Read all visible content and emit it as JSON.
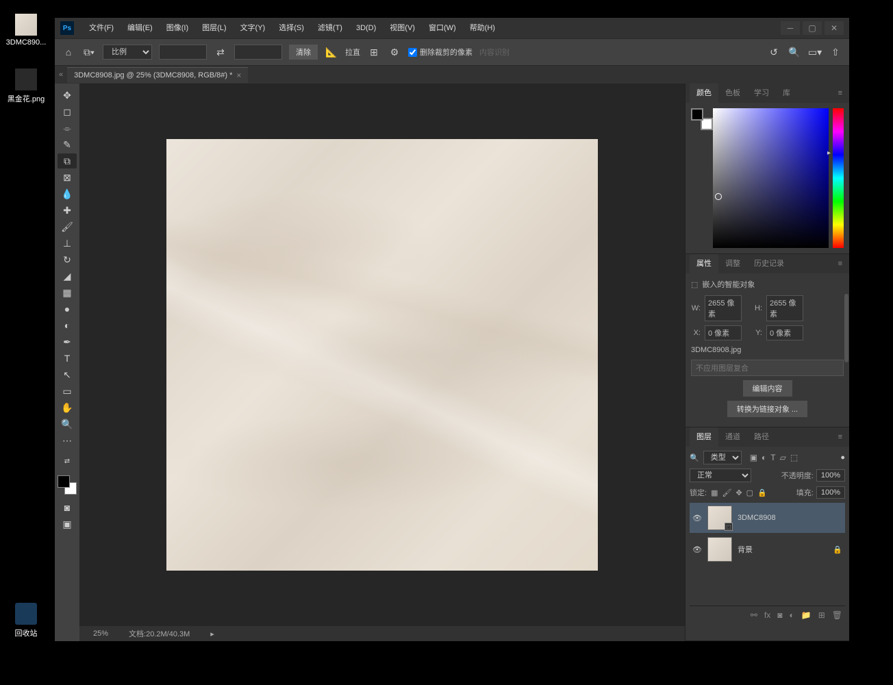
{
  "desktop": {
    "icon1": "3DMC890...",
    "icon2": "黑金花.png",
    "trash": "回收站"
  },
  "menu": {
    "file": "文件(F)",
    "edit": "编辑(E)",
    "image": "图像(I)",
    "layer": "图层(L)",
    "type": "文字(Y)",
    "select": "选择(S)",
    "filter": "滤镜(T)",
    "threed": "3D(D)",
    "view": "视图(V)",
    "window": "窗口(W)",
    "help": "帮助(H)"
  },
  "optbar": {
    "ratio": "比例",
    "clear": "清除",
    "straighten": "拉直",
    "deleteCropped": "删除裁剪的像素",
    "contentAware": "内容识别"
  },
  "doc": {
    "tab": "3DMC8908.jpg @ 25% (3DMC8908, RGB/8#) *"
  },
  "status": {
    "zoom": "25%",
    "docsize": "文档:20.2M/40.3M"
  },
  "panels": {
    "color": {
      "t1": "颜色",
      "t2": "色板",
      "t3": "学习",
      "t4": "库"
    },
    "props": {
      "t1": "属性",
      "t2": "调整",
      "t3": "历史记录",
      "type": "嵌入的智能对象",
      "wLabel": "W:",
      "wVal": "2655 像素",
      "hLabel": "H:",
      "hVal": "2655 像素",
      "xLabel": "X:",
      "xVal": "0 像素",
      "yLabel": "Y:",
      "yVal": "0 像素",
      "filename": "3DMC8908.jpg",
      "layerComp": "不应用图层复合",
      "editBtn": "编辑内容",
      "convertBtn": "转换为链接对象 ..."
    },
    "layers": {
      "t1": "图层",
      "t2": "通道",
      "t3": "路径",
      "kind": "类型",
      "blend": "正常",
      "opacityLabel": "不透明度:",
      "opacity": "100%",
      "lockLabel": "锁定:",
      "fillLabel": "填充:",
      "fill": "100%",
      "layer1": "3DMC8908",
      "layer2": "背景"
    }
  }
}
